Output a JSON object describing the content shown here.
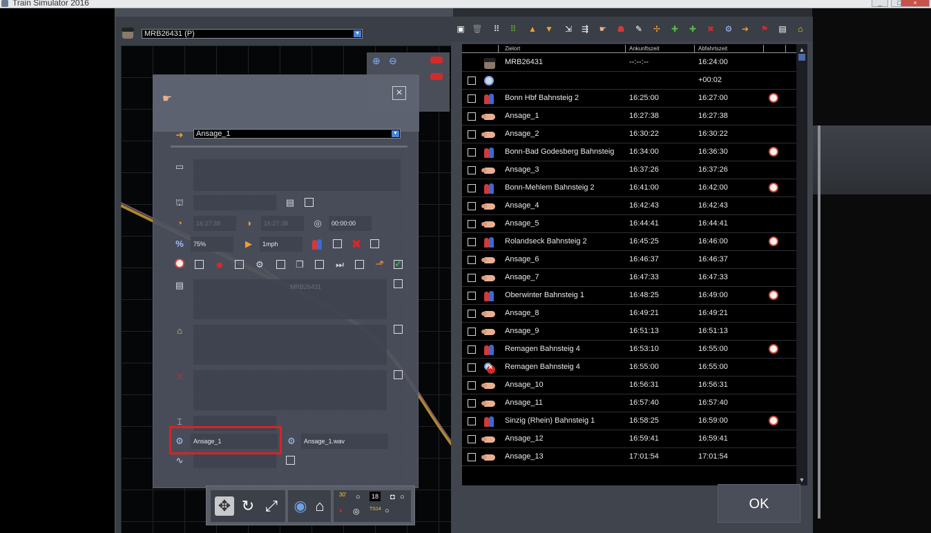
{
  "window": {
    "title": "Train Simulator 2016",
    "min": "_",
    "max": "□",
    "close": "×"
  },
  "editor": {
    "service_select": "MRB26431 (P)",
    "instruction_select": "Ansage_1",
    "fields": {
      "arrival_time": "16:27:38",
      "departure_time": "16:27:38",
      "duration": "00:00:00",
      "percent": "75%",
      "speed": "1mph",
      "ghost_label": "MRB26431",
      "trigger_name": "Ansage_1",
      "sound_file": "Ansage_1.wav"
    },
    "bottom_bar": {
      "counter": "18",
      "label_a": "30'",
      "label_b": "TS14"
    }
  },
  "timetable": {
    "columns": [
      "Zielort",
      "Ankunftszeit",
      "Abfahrtszeit"
    ],
    "ok_label": "OK",
    "rows": [
      {
        "icon": "driver-icon",
        "name": "MRB26431",
        "arr": "--:--:--",
        "dep": "16:24:00",
        "alarm": false,
        "check": false
      },
      {
        "icon": "cog-icon",
        "name": "",
        "arr": "",
        "dep": "+00:02",
        "alarm": false,
        "check": true
      },
      {
        "icon": "passengers-icon",
        "name": "Bonn Hbf Bahnsteig 2",
        "arr": "16:25:00",
        "dep": "16:27:00",
        "alarm": true,
        "check": true
      },
      {
        "icon": "pointing-hand-icon",
        "name": "Ansage_1",
        "arr": "16:27:38",
        "dep": "16:27:38",
        "alarm": false,
        "check": true
      },
      {
        "icon": "pointing-hand-icon",
        "name": "Ansage_2",
        "arr": "16:30:22",
        "dep": "16:30:22",
        "alarm": false,
        "check": true
      },
      {
        "icon": "passengers-icon",
        "name": "Bonn-Bad Godesberg Bahnsteig",
        "arr": "16:34:00",
        "dep": "16:36:30",
        "alarm": true,
        "check": true
      },
      {
        "icon": "pointing-hand-icon",
        "name": "Ansage_3",
        "arr": "16:37:26",
        "dep": "16:37:26",
        "alarm": false,
        "check": true
      },
      {
        "icon": "passengers-icon",
        "name": "Bonn-Mehlem Bahnsteig 2",
        "arr": "16:41:00",
        "dep": "16:42:00",
        "alarm": true,
        "check": true
      },
      {
        "icon": "pointing-hand-icon",
        "name": "Ansage_4",
        "arr": "16:42:43",
        "dep": "16:42:43",
        "alarm": false,
        "check": true
      },
      {
        "icon": "pointing-hand-icon",
        "name": "Ansage_5",
        "arr": "16:44:41",
        "dep": "16:44:41",
        "alarm": false,
        "check": true
      },
      {
        "icon": "passengers-icon",
        "name": "Rolandseck Bahnsteig 2",
        "arr": "16:45:25",
        "dep": "16:46:00",
        "alarm": true,
        "check": true
      },
      {
        "icon": "pointing-hand-icon",
        "name": "Ansage_6",
        "arr": "16:46:37",
        "dep": "16:46:37",
        "alarm": false,
        "check": true
      },
      {
        "icon": "pointing-hand-icon",
        "name": "Ansage_7",
        "arr": "16:47:33",
        "dep": "16:47:33",
        "alarm": false,
        "check": true
      },
      {
        "icon": "passengers-icon",
        "name": "Oberwinter Bahnsteig 1",
        "arr": "16:48:25",
        "dep": "16:49:00",
        "alarm": true,
        "check": true
      },
      {
        "icon": "pointing-hand-icon",
        "name": "Ansage_8",
        "arr": "16:49:21",
        "dep": "16:49:21",
        "alarm": false,
        "check": true
      },
      {
        "icon": "pointing-hand-icon",
        "name": "Ansage_9",
        "arr": "16:51:13",
        "dep": "16:51:13",
        "alarm": false,
        "check": true
      },
      {
        "icon": "passengers-icon",
        "name": "Remagen Bahnsteig 4",
        "arr": "16:53:10",
        "dep": "16:55:00",
        "alarm": true,
        "check": true
      },
      {
        "icon": "no-stop-icon",
        "name": "Remagen Bahnsteig 4",
        "arr": "16:55:00",
        "dep": "16:55:00",
        "alarm": false,
        "check": true
      },
      {
        "icon": "pointing-hand-icon",
        "name": "Ansage_10",
        "arr": "16:56:31",
        "dep": "16:56:31",
        "alarm": false,
        "check": true
      },
      {
        "icon": "pointing-hand-icon",
        "name": "Ansage_11",
        "arr": "16:57:40",
        "dep": "16:57:40",
        "alarm": false,
        "check": true
      },
      {
        "icon": "passengers-icon",
        "name": "Sinzig (Rhein) Bahnsteig 1",
        "arr": "16:58:25",
        "dep": "16:59:00",
        "alarm": true,
        "check": true
      },
      {
        "icon": "pointing-hand-icon",
        "name": "Ansage_12",
        "arr": "16:59:41",
        "dep": "16:59:41",
        "alarm": false,
        "check": true
      },
      {
        "icon": "pointing-hand-icon",
        "name": "Ansage_13",
        "arr": "17:01:54",
        "dep": "17:01:54",
        "alarm": false,
        "check": true
      }
    ]
  }
}
